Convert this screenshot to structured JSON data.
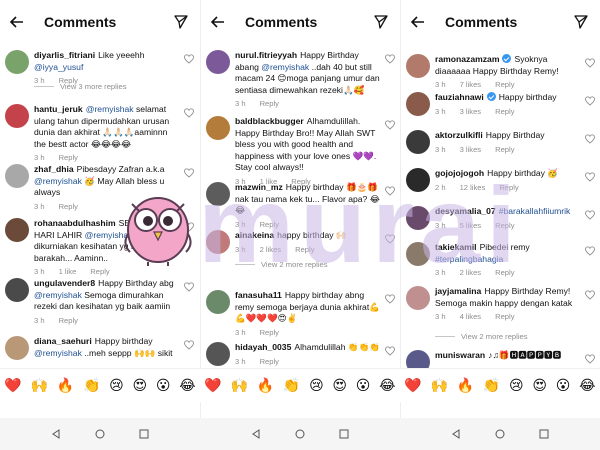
{
  "header": {
    "title": "Comments"
  },
  "watermark": "murai",
  "panels": [
    {
      "comments": [
        {
          "user": "diyarlis_fitriani",
          "parts": [
            {
              "t": "Like yeeehh "
            },
            {
              "m": "@iyya_yusuf"
            }
          ],
          "time": "3 h",
          "reply": "Reply"
        },
        {
          "more": "View 3 more replies"
        },
        {
          "user": "hantu_jeruk",
          "parts": [
            {
              "m": "@remyishak"
            },
            {
              "t": " selamat ulang tahun dipermudahkan urusan dunia dan akhirat 🙏🏻🙏🏻🙏🏻aaminnn the bestt actor 😂😂😂😂"
            }
          ],
          "time": "3 h",
          "reply": "Reply"
        },
        {
          "user": "zhaf_dhia",
          "parts": [
            {
              "t": "Pibesdayy Zafran a.k.a "
            },
            {
              "m": "@remyishak"
            },
            {
              "t": " 🥳 May Allah bless u always"
            }
          ],
          "time": "3 h",
          "reply": "Reply"
        },
        {
          "user": "rohanaabdulhashim",
          "parts": [
            {
              "t": "SELAMAT HARI LAHIR "
            },
            {
              "m": "@remyishak"
            },
            {
              "t": " semoga dikurniakan kesihatan yg baik dan barakah... Aaminn.."
            }
          ],
          "time": "3 h",
          "likes": "1 like",
          "reply": "Reply"
        },
        {
          "user": "ungulavender8",
          "parts": [
            {
              "t": "Happy Birthday abg "
            },
            {
              "m": "@remyishak"
            },
            {
              "t": " Semoga dimurahkan rezeki dan kesihatan yg baik aamiin"
            }
          ],
          "time": "3 h",
          "reply": "Reply"
        },
        {
          "user": "diana_saehuri",
          "parts": [
            {
              "t": "Happy birthday "
            },
            {
              "m": "@remyishak"
            },
            {
              "t": " ..meh seppp 🙌🙌 sikit"
            }
          ],
          "time": "",
          "reply": ""
        }
      ]
    },
    {
      "comments": [
        {
          "user": "nurul.fitrieyyah",
          "parts": [
            {
              "t": "Happy Birthday abang "
            },
            {
              "m": "@remyishak"
            },
            {
              "t": " ..dah 40 but still macam 24 😊moga panjang umur dan sentiasa dimewahkan rezeki🙏🏻🥰"
            }
          ],
          "time": "3 h",
          "reply": "Reply"
        },
        {
          "user": "baldblackbugger",
          "parts": [
            {
              "t": "Alhamdulillah. Happy Birthday Bro!! May Allah SWT bless you with good health and happiness with your love ones 💜💜. Stay cool always!!"
            }
          ],
          "time": "3 h",
          "likes": "1 like",
          "reply": "Reply"
        },
        {
          "user": "mazwin_mz",
          "parts": [
            {
              "t": "Happy birthday 🎁🎂🎁 nak tau nama kek tu... Flavor apa? 😂😂"
            }
          ],
          "time": "3 h",
          "reply": "Reply"
        },
        {
          "user": "ainakeina",
          "parts": [
            {
              "t": "happy birthday 🙌🏻"
            }
          ],
          "time": "3 h",
          "likes": "2 likes",
          "reply": "Reply"
        },
        {
          "more": "View 2 more replies"
        },
        {
          "user": "fanasuha11",
          "parts": [
            {
              "t": "Happy birthday abng remy semoga berjaya dunia akhirat💪💪❤️❤️❤️😍✌️"
            }
          ],
          "time": "3 h",
          "reply": "Reply"
        },
        {
          "user": "hidayah_0035",
          "parts": [
            {
              "t": "Alhamdulillah 👏👏👏"
            }
          ],
          "time": "3 h",
          "reply": "Reply"
        }
      ]
    },
    {
      "comments": [
        {
          "user": "ramonazamzam",
          "verified": true,
          "parts": [
            {
              "t": "Syoknya diaaaaaa Happy Birthday Remy!"
            }
          ],
          "time": "3 h",
          "likes": "7 likes",
          "reply": "Reply"
        },
        {
          "user": "fauziahnawi",
          "verified": true,
          "parts": [
            {
              "t": "Happy birthday"
            }
          ],
          "time": "3 h",
          "likes": "3 likes",
          "reply": "Reply"
        },
        {
          "user": "aktorzulkifli",
          "parts": [
            {
              "t": "Happy Birthday"
            }
          ],
          "time": "3 h",
          "likes": "3 likes",
          "reply": "Reply"
        },
        {
          "user": "gojojojogoh",
          "parts": [
            {
              "t": "Happy birthday 🥳"
            }
          ],
          "time": "2 h",
          "likes": "12 likes",
          "reply": "Reply"
        },
        {
          "user": "desyamalia_07",
          "parts": [
            {
              "g": "#barakallahfiiumrik"
            }
          ],
          "time": "3 h",
          "likes": "5 likes",
          "reply": "Reply"
        },
        {
          "user": "takiekamil",
          "parts": [
            {
              "t": "Pibedei remy "
            },
            {
              "g": "#terpalingbahagia"
            }
          ],
          "time": "3 h",
          "likes": "2 likes",
          "reply": "Reply"
        },
        {
          "user": "jayjamalina",
          "parts": [
            {
              "t": "Happy Birthday Remy! Semoga makin happy dengan katak"
            }
          ],
          "time": "3 h",
          "likes": "4 likes",
          "reply": "Reply"
        },
        {
          "more": "View 2 more replies"
        },
        {
          "user": "muniswaran",
          "parts": [
            {
              "t": "♪♫🎁🅷🅰🅿🅿🆈🅱"
            }
          ],
          "time": "",
          "reply": ""
        }
      ]
    }
  ],
  "emoji_bar": [
    "❤️",
    "🙌",
    "🔥",
    "👏",
    "😢",
    "😍",
    "😮",
    "😂",
    "❤️",
    "🙌",
    "🔥",
    "👏",
    "😢",
    "😍",
    "😮",
    "😂",
    "❤️",
    "🙌",
    "🔥",
    "👏",
    "😢",
    "😍",
    "😮",
    "😂"
  ],
  "colors": {
    "mention": "#1d4f91",
    "meta": "#8e8e8e",
    "verified": "#3897f0"
  },
  "icons": {
    "back": "arrow-left-icon",
    "send": "direct-send-icon",
    "like": "heart-outline-icon"
  }
}
